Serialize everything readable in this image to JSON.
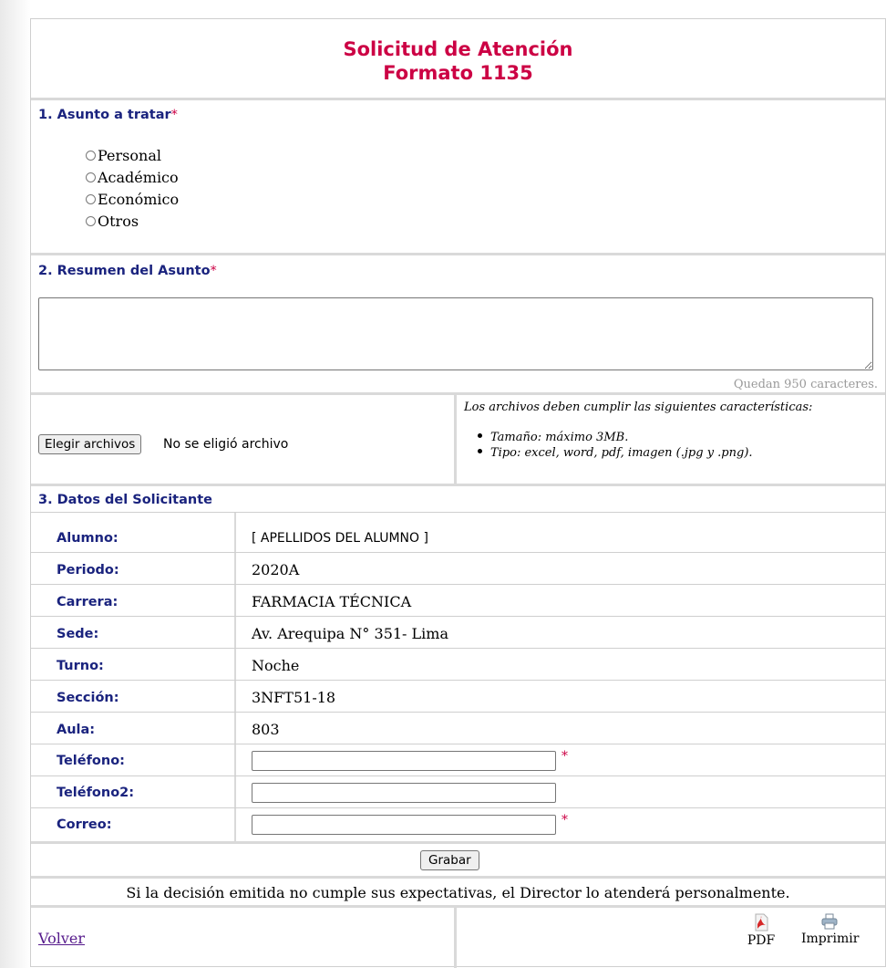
{
  "form": {
    "title_line1": "Solicitud de Atención",
    "title_line2": "Formato 1135"
  },
  "section1": {
    "label": "1. Asunto a tratar",
    "required_mark": "*",
    "options": [
      "Personal",
      "Académico",
      "Económico",
      "Otros"
    ]
  },
  "section2": {
    "label": "2. Resumen del Asunto",
    "required_mark": "*",
    "summary_value": "",
    "counter_text": "Quedan 950 caracteres."
  },
  "files": {
    "button_label": "Elegir archivos",
    "status": "No se eligió archivo",
    "note": "Los archivos deben cumplir las siguientes características:",
    "rules": [
      "Tamaño: máximo 3MB.",
      "Tipo: excel, word, pdf, imagen (.jpg y .png)."
    ]
  },
  "section3": {
    "label": "3. Datos del Solicitante",
    "rows": [
      {
        "label": "Alumno:",
        "value": "[ APELLIDOS DEL ALUMNO ]"
      },
      {
        "label": "Periodo:",
        "value": "2020A"
      },
      {
        "label": "Carrera:",
        "value": "FARMACIA TÉCNICA"
      },
      {
        "label": "Sede:",
        "value": "Av. Arequipa N° 351- Lima"
      },
      {
        "label": "Turno:",
        "value": "Noche"
      },
      {
        "label": "Sección:",
        "value": "3NFT51-18"
      },
      {
        "label": "Aula:",
        "value": "803"
      }
    ],
    "inputs": [
      {
        "label": "Teléfono:",
        "value": "",
        "required_mark": "*"
      },
      {
        "label": "Teléfono2:",
        "value": "",
        "required_mark": ""
      },
      {
        "label": "Correo:",
        "value": "",
        "required_mark": "*"
      }
    ]
  },
  "actions": {
    "save_label": "Grabar",
    "notice": "Si la decisión emitida no cumple sus expectativas, el Director lo atenderá personalmente.",
    "back_link": "Volver",
    "pdf_label": "PDF",
    "print_label": "Imprimir"
  },
  "colors": {
    "title": "#cc0044",
    "label": "#1a237e",
    "required": "#cc0044",
    "link": "#551a8b"
  }
}
